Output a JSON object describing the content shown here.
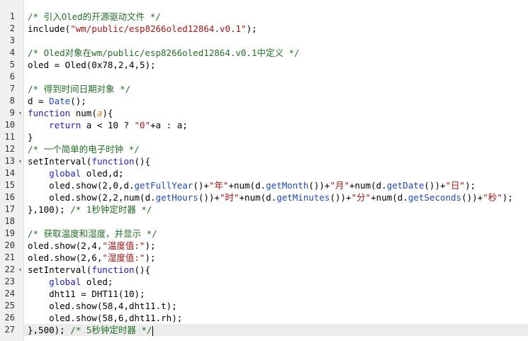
{
  "editor": {
    "active_line": 27,
    "cursor_line": 27,
    "fold_lines": [
      9,
      13,
      22
    ],
    "colors": {
      "comment": "#236e25",
      "keyword": "#2020c0",
      "string": "#a31515",
      "builtin": "#1f49b3",
      "param": "#d08020",
      "gutter": "#f0f0f0",
      "active_line": "#ececec"
    },
    "lines": [
      {
        "n": "1",
        "tokens": [
          [
            "comment",
            "/* 引入Oled的开源驱动文件 */"
          ]
        ]
      },
      {
        "n": "2",
        "tokens": [
          [
            "plain",
            "include("
          ],
          [
            "string",
            "\"wm/public/esp8266oled12864.v0.1\""
          ],
          [
            "plain",
            ");"
          ]
        ]
      },
      {
        "n": "3",
        "tokens": []
      },
      {
        "n": "4",
        "tokens": [
          [
            "comment",
            "/* Oled对象在wm/public/esp8266oled12864.v0.1中定义 */"
          ]
        ]
      },
      {
        "n": "5",
        "tokens": [
          [
            "plain",
            "oled = Oled(0x78,2,4,5);"
          ]
        ]
      },
      {
        "n": "6",
        "tokens": []
      },
      {
        "n": "7",
        "tokens": [
          [
            "comment",
            "/* 得到时间日期对象 */"
          ]
        ]
      },
      {
        "n": "8",
        "tokens": [
          [
            "plain",
            "d = "
          ],
          [
            "builtin",
            "Date"
          ],
          [
            "plain",
            "();"
          ]
        ]
      },
      {
        "n": "9",
        "tokens": [
          [
            "keyword",
            "function"
          ],
          [
            "plain",
            " num("
          ],
          [
            "param",
            "a"
          ],
          [
            "plain",
            "){"
          ]
        ]
      },
      {
        "n": "10",
        "tokens": [
          [
            "plain",
            "    "
          ],
          [
            "keyword",
            "return"
          ],
          [
            "plain",
            " a < 10 ? "
          ],
          [
            "string",
            "\"0\""
          ],
          [
            "plain",
            "+a : a;"
          ]
        ]
      },
      {
        "n": "11",
        "tokens": [
          [
            "plain",
            "}"
          ]
        ]
      },
      {
        "n": "12",
        "tokens": [
          [
            "comment",
            "/* 一个简单的电子时钟 */"
          ]
        ]
      },
      {
        "n": "13",
        "tokens": [
          [
            "plain",
            "setInterval("
          ],
          [
            "keyword",
            "function"
          ],
          [
            "plain",
            "(){"
          ]
        ]
      },
      {
        "n": "14",
        "tokens": [
          [
            "plain",
            "    "
          ],
          [
            "keyword",
            "global"
          ],
          [
            "plain",
            " oled,d;"
          ]
        ]
      },
      {
        "n": "15",
        "tokens": [
          [
            "plain",
            "    oled.show(2,0,d."
          ],
          [
            "builtin",
            "getFullYear"
          ],
          [
            "plain",
            "()+"
          ],
          [
            "string",
            "\"年\""
          ],
          [
            "plain",
            "+num(d."
          ],
          [
            "builtin",
            "getMonth"
          ],
          [
            "plain",
            "())+"
          ],
          [
            "string",
            "\"月\""
          ],
          [
            "plain",
            "+num(d."
          ],
          [
            "builtin",
            "getDate"
          ],
          [
            "plain",
            "())+"
          ],
          [
            "string",
            "\"日\""
          ],
          [
            "plain",
            ");"
          ]
        ]
      },
      {
        "n": "16",
        "tokens": [
          [
            "plain",
            "    oled.show(2,2,num(d."
          ],
          [
            "builtin",
            "getHours"
          ],
          [
            "plain",
            "())+"
          ],
          [
            "string",
            "\"时\""
          ],
          [
            "plain",
            "+num(d."
          ],
          [
            "builtin",
            "getMinutes"
          ],
          [
            "plain",
            "())+"
          ],
          [
            "string",
            "\"分\""
          ],
          [
            "plain",
            "+num(d."
          ],
          [
            "builtin",
            "getSeconds"
          ],
          [
            "plain",
            "())+"
          ],
          [
            "string",
            "\"秒\""
          ],
          [
            "plain",
            ");"
          ]
        ]
      },
      {
        "n": "17",
        "tokens": [
          [
            "plain",
            "},100); "
          ],
          [
            "comment",
            "/* 1秒钟定时器 */"
          ]
        ]
      },
      {
        "n": "18",
        "tokens": []
      },
      {
        "n": "19",
        "tokens": [
          [
            "comment",
            "/* 获取温度和湿度，并显示 */"
          ]
        ]
      },
      {
        "n": "20",
        "tokens": [
          [
            "plain",
            "oled.show(2,4,"
          ],
          [
            "string",
            "\"温度值:\""
          ],
          [
            "plain",
            ");"
          ]
        ]
      },
      {
        "n": "21",
        "tokens": [
          [
            "plain",
            "oled.show(2,6,"
          ],
          [
            "string",
            "\"湿度值:\""
          ],
          [
            "plain",
            ");"
          ]
        ]
      },
      {
        "n": "22",
        "tokens": [
          [
            "plain",
            "setInterval("
          ],
          [
            "keyword",
            "function"
          ],
          [
            "plain",
            "(){"
          ]
        ]
      },
      {
        "n": "23",
        "tokens": [
          [
            "plain",
            "    "
          ],
          [
            "keyword",
            "global"
          ],
          [
            "plain",
            " oled;"
          ]
        ]
      },
      {
        "n": "24",
        "tokens": [
          [
            "plain",
            "    dht11 = DHT11(10);"
          ]
        ]
      },
      {
        "n": "25",
        "tokens": [
          [
            "plain",
            "    oled.show(58,4,dht11.t);"
          ]
        ]
      },
      {
        "n": "26",
        "tokens": [
          [
            "plain",
            "    oled.show(58,6,dht11.rh);"
          ]
        ]
      },
      {
        "n": "27",
        "tokens": [
          [
            "plain",
            "},500); "
          ],
          [
            "comment",
            "/* 5秒钟定时器 */"
          ]
        ]
      }
    ]
  }
}
